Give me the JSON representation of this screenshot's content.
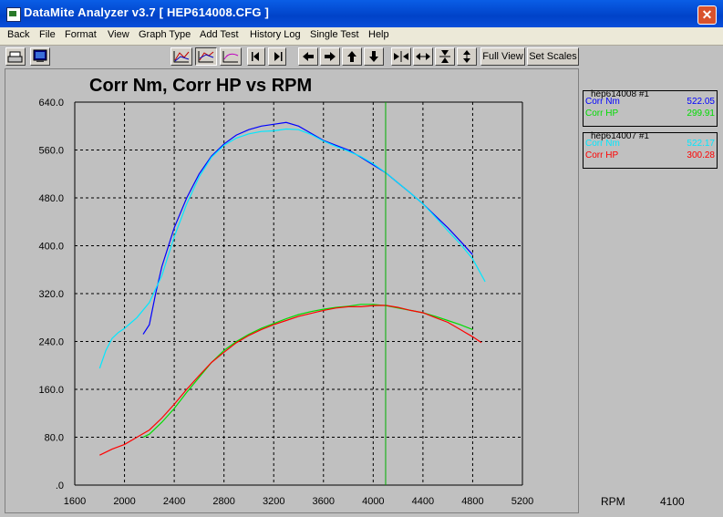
{
  "window": {
    "title": "DataMite Analyzer v3.7  [ HEP614008.CFG ]"
  },
  "menu": [
    "Back",
    "File",
    "Format",
    "View",
    "Graph Type",
    "Add Test",
    "History Log",
    "Single Test",
    "Help"
  ],
  "toolbar": {
    "full_view": "Full View",
    "set_scales": "Set Scales"
  },
  "colors": {
    "nm1": "#0000ff",
    "hp1": "#00dd00",
    "nm2": "#00e8ff",
    "hp2": "#ff0000",
    "cursor": "#00b000"
  },
  "chart_data": {
    "type": "line",
    "title": "Corr Nm, Corr HP vs RPM",
    "xlim": [
      1600,
      5200
    ],
    "ylim": [
      0,
      640
    ],
    "x_ticks": [
      "1600",
      "2000",
      "2400",
      "2800",
      "3200",
      "3600",
      "4000",
      "4400",
      "4800",
      "5200"
    ],
    "y_ticks": [
      ".0",
      "80.0",
      "160.0",
      "240.0",
      "320.0",
      "400.0",
      "480.0",
      "560.0",
      "640.0"
    ],
    "grid": true,
    "cursor_rpm": 4100,
    "series": [
      {
        "key": "nm1",
        "points": [
          [
            2150,
            252
          ],
          [
            2200,
            268
          ],
          [
            2250,
            320
          ],
          [
            2300,
            365
          ],
          [
            2400,
            430
          ],
          [
            2500,
            480
          ],
          [
            2600,
            520
          ],
          [
            2700,
            550
          ],
          [
            2800,
            570
          ],
          [
            2900,
            585
          ],
          [
            3000,
            594
          ],
          [
            3100,
            600
          ],
          [
            3200,
            603
          ],
          [
            3300,
            606
          ],
          [
            3400,
            600
          ],
          [
            3500,
            588
          ],
          [
            3600,
            576
          ],
          [
            3700,
            568
          ],
          [
            3800,
            560
          ],
          [
            3900,
            548
          ],
          [
            4000,
            535
          ],
          [
            4100,
            522
          ],
          [
            4200,
            505
          ],
          [
            4300,
            488
          ],
          [
            4400,
            470
          ],
          [
            4500,
            450
          ],
          [
            4600,
            430
          ],
          [
            4700,
            408
          ],
          [
            4800,
            385
          ]
        ]
      },
      {
        "key": "hp1",
        "points": [
          [
            2150,
            80
          ],
          [
            2200,
            85
          ],
          [
            2300,
            105
          ],
          [
            2400,
            128
          ],
          [
            2500,
            155
          ],
          [
            2600,
            180
          ],
          [
            2700,
            205
          ],
          [
            2800,
            225
          ],
          [
            2900,
            240
          ],
          [
            3000,
            252
          ],
          [
            3100,
            262
          ],
          [
            3200,
            270
          ],
          [
            3300,
            278
          ],
          [
            3400,
            285
          ],
          [
            3500,
            290
          ],
          [
            3600,
            294
          ],
          [
            3700,
            297
          ],
          [
            3800,
            299
          ],
          [
            3900,
            302
          ],
          [
            4000,
            302
          ],
          [
            4100,
            299.91
          ],
          [
            4200,
            296
          ],
          [
            4300,
            292
          ],
          [
            4400,
            288
          ],
          [
            4500,
            282
          ],
          [
            4600,
            275
          ],
          [
            4700,
            268
          ],
          [
            4800,
            260
          ]
        ]
      },
      {
        "key": "nm2",
        "points": [
          [
            1800,
            195
          ],
          [
            1850,
            225
          ],
          [
            1900,
            245
          ],
          [
            1950,
            255
          ],
          [
            2000,
            262
          ],
          [
            2100,
            280
          ],
          [
            2200,
            305
          ],
          [
            2300,
            350
          ],
          [
            2400,
            415
          ],
          [
            2500,
            470
          ],
          [
            2600,
            515
          ],
          [
            2700,
            548
          ],
          [
            2800,
            568
          ],
          [
            2900,
            580
          ],
          [
            3000,
            587
          ],
          [
            3100,
            591
          ],
          [
            3200,
            592
          ],
          [
            3300,
            595
          ],
          [
            3400,
            594
          ],
          [
            3500,
            586
          ],
          [
            3600,
            575
          ],
          [
            3700,
            566
          ],
          [
            3800,
            558
          ],
          [
            3900,
            549
          ],
          [
            4000,
            537
          ],
          [
            4100,
            522.17
          ],
          [
            4200,
            505
          ],
          [
            4300,
            488
          ],
          [
            4400,
            470
          ],
          [
            4500,
            448
          ],
          [
            4600,
            425
          ],
          [
            4700,
            403
          ],
          [
            4800,
            378
          ],
          [
            4900,
            340
          ]
        ]
      },
      {
        "key": "hp2",
        "points": [
          [
            1800,
            50
          ],
          [
            1900,
            60
          ],
          [
            2000,
            68
          ],
          [
            2100,
            80
          ],
          [
            2200,
            92
          ],
          [
            2300,
            112
          ],
          [
            2400,
            135
          ],
          [
            2500,
            160
          ],
          [
            2600,
            183
          ],
          [
            2700,
            205
          ],
          [
            2800,
            222
          ],
          [
            2900,
            238
          ],
          [
            3000,
            250
          ],
          [
            3100,
            260
          ],
          [
            3200,
            268
          ],
          [
            3300,
            275
          ],
          [
            3400,
            282
          ],
          [
            3500,
            287
          ],
          [
            3600,
            292
          ],
          [
            3700,
            296
          ],
          [
            3800,
            298
          ],
          [
            3900,
            298
          ],
          [
            4000,
            300
          ],
          [
            4100,
            300.28
          ],
          [
            4200,
            297
          ],
          [
            4300,
            292
          ],
          [
            4400,
            288
          ],
          [
            4500,
            280
          ],
          [
            4600,
            272
          ],
          [
            4700,
            260
          ],
          [
            4800,
            248
          ],
          [
            4870,
            238
          ]
        ]
      }
    ]
  },
  "legend": [
    {
      "header": "hep614008   #1",
      "rows": [
        {
          "name": "Corr Nm",
          "value": "522.05",
          "color": "#0000ff"
        },
        {
          "name": "Corr HP",
          "value": "299.91",
          "color": "#00dd00"
        }
      ]
    },
    {
      "header": "hep614007   #1",
      "rows": [
        {
          "name": "Corr Nm",
          "value": "522.17",
          "color": "#00e8ff"
        },
        {
          "name": "Corr HP",
          "value": "300.28",
          "color": "#ff0000"
        }
      ]
    }
  ],
  "cursor": {
    "label": "RPM",
    "value": "4100"
  }
}
